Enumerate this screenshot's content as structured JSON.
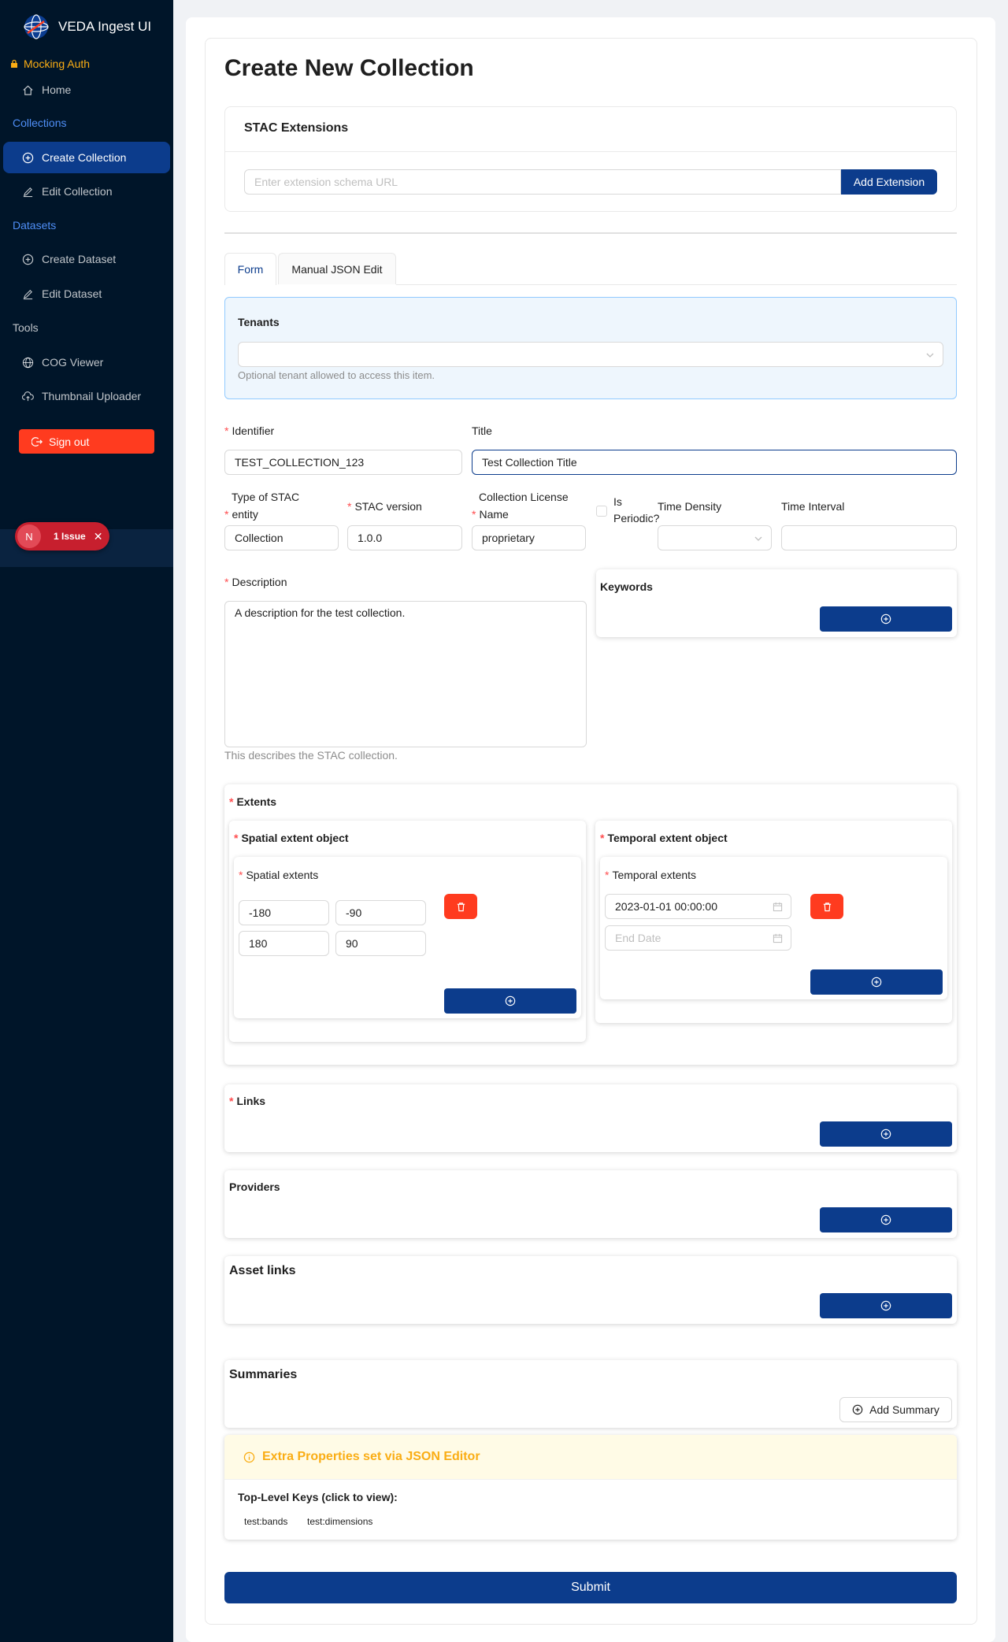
{
  "app": {
    "title": "VEDA Ingest UI"
  },
  "sidebar": {
    "auth_label": "Mocking Auth",
    "home": "Home",
    "group_collections": "Collections",
    "create_collection": "Create Collection",
    "edit_collection": "Edit Collection",
    "group_datasets": "Datasets",
    "create_dataset": "Create Dataset",
    "edit_dataset": "Edit Dataset",
    "group_tools": "Tools",
    "cog_viewer": "COG Viewer",
    "thumbnail_uploader": "Thumbnail Uploader",
    "sign_out": "Sign out"
  },
  "issues": {
    "letter": "N",
    "label": "1 Issue"
  },
  "page": {
    "title": "Create New Collection"
  },
  "extensions": {
    "title": "STAC Extensions",
    "placeholder": "Enter extension schema URL",
    "add_button": "Add Extension"
  },
  "tabs": {
    "form": "Form",
    "json": "Manual JSON Edit"
  },
  "tenants": {
    "label": "Tenants",
    "help": "Optional tenant allowed to access this item."
  },
  "fields": {
    "identifier": {
      "label": "Identifier",
      "value": "TEST_COLLECTION_123"
    },
    "title": {
      "label": "Title",
      "value": "Test Collection Title"
    },
    "type": {
      "label_line1": "Type of STAC",
      "label_line2": "entity",
      "value": "Collection"
    },
    "stac_version": {
      "label": "STAC version",
      "value": "1.0.0"
    },
    "license": {
      "label_line1": "Collection License",
      "label_line2": "Name",
      "value": "proprietary"
    },
    "periodic": {
      "label_line1": "Is",
      "label_line2": "Periodic?"
    },
    "time_density": {
      "label": "Time Density"
    },
    "time_interval": {
      "label": "Time Interval"
    },
    "description": {
      "label": "Description",
      "value": "A description for the test collection.",
      "help": "This describes the STAC collection."
    }
  },
  "keywords": {
    "title": "Keywords"
  },
  "extents": {
    "title": "Extents",
    "spatial_title": "Spatial extent object",
    "spatial_sub": "Spatial extents",
    "bbox": [
      "-180",
      "-90",
      "180",
      "90"
    ],
    "temporal_title": "Temporal extent object",
    "temporal_sub": "Temporal extents",
    "start": "2023-01-01 00:00:00",
    "end_placeholder": "End Date"
  },
  "links": {
    "title": "Links"
  },
  "providers": {
    "title": "Providers"
  },
  "asset_links": {
    "title": "Asset links"
  },
  "summaries": {
    "title": "Summaries",
    "add_button": "Add Summary"
  },
  "extra": {
    "title": "Extra Properties set via JSON Editor",
    "keys_label": "Top-Level Keys (click to view):",
    "keys": [
      "test:bands",
      "test:dimensions"
    ]
  },
  "submit": "Submit",
  "colors": {
    "primary": "#0c3c8c",
    "danger": "#ff3b1f",
    "sidebar": "#001529",
    "warning": "#faad14"
  }
}
